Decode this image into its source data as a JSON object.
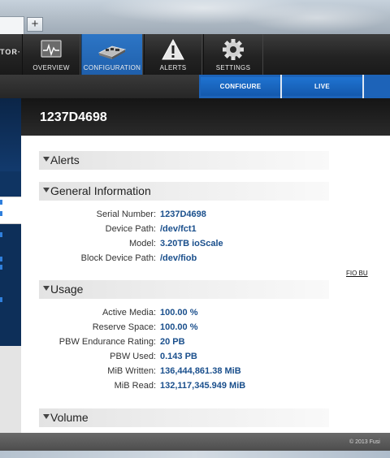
{
  "browser": {
    "new_tab_label": "+"
  },
  "brand": {
    "text": "TOR·"
  },
  "nav": [
    {
      "label": "OVERVIEW",
      "icon": "overview-icon"
    },
    {
      "label": "CONFIGURATION",
      "icon": "configuration-icon"
    },
    {
      "label": "ALERTS",
      "icon": "alert-icon"
    },
    {
      "label": "SETTINGS",
      "icon": "gear-icon"
    }
  ],
  "subnav": {
    "configure_label": "CONFIGURE",
    "live_label": "LIVE"
  },
  "device": {
    "title": "1237D4698"
  },
  "sections": {
    "alerts": "Alerts",
    "general": "General Information",
    "usage": "Usage",
    "volume": "Volume"
  },
  "general_info": [
    {
      "label": "Serial Number:",
      "value": "1237D4698"
    },
    {
      "label": "Device Path:",
      "value": "/dev/fct1"
    },
    {
      "label": "Model:",
      "value": "3.20TB ioScale"
    },
    {
      "label": "Block Device Path:",
      "value": "/dev/fiob"
    }
  ],
  "usage": [
    {
      "label": "Active Media:",
      "value": "100.00 %"
    },
    {
      "label": "Reserve Space:",
      "value": "100.00 %"
    },
    {
      "label": "PBW Endurance Rating:",
      "value": "20 PB"
    },
    {
      "label": "PBW Used:",
      "value": "0.143 PB"
    },
    {
      "label": "MiB Written:",
      "value": "136,444,861.38 MiB"
    },
    {
      "label": "MiB Read:",
      "value": "132,117,345.949 MiB"
    }
  ],
  "links": {
    "fio_label": "FIO BU"
  },
  "footer": {
    "copyright": "© 2013 Fusi"
  },
  "colors": {
    "accent": "#1d63b8",
    "value_text": "#1a4f8c",
    "navy": "#0d2f59"
  }
}
